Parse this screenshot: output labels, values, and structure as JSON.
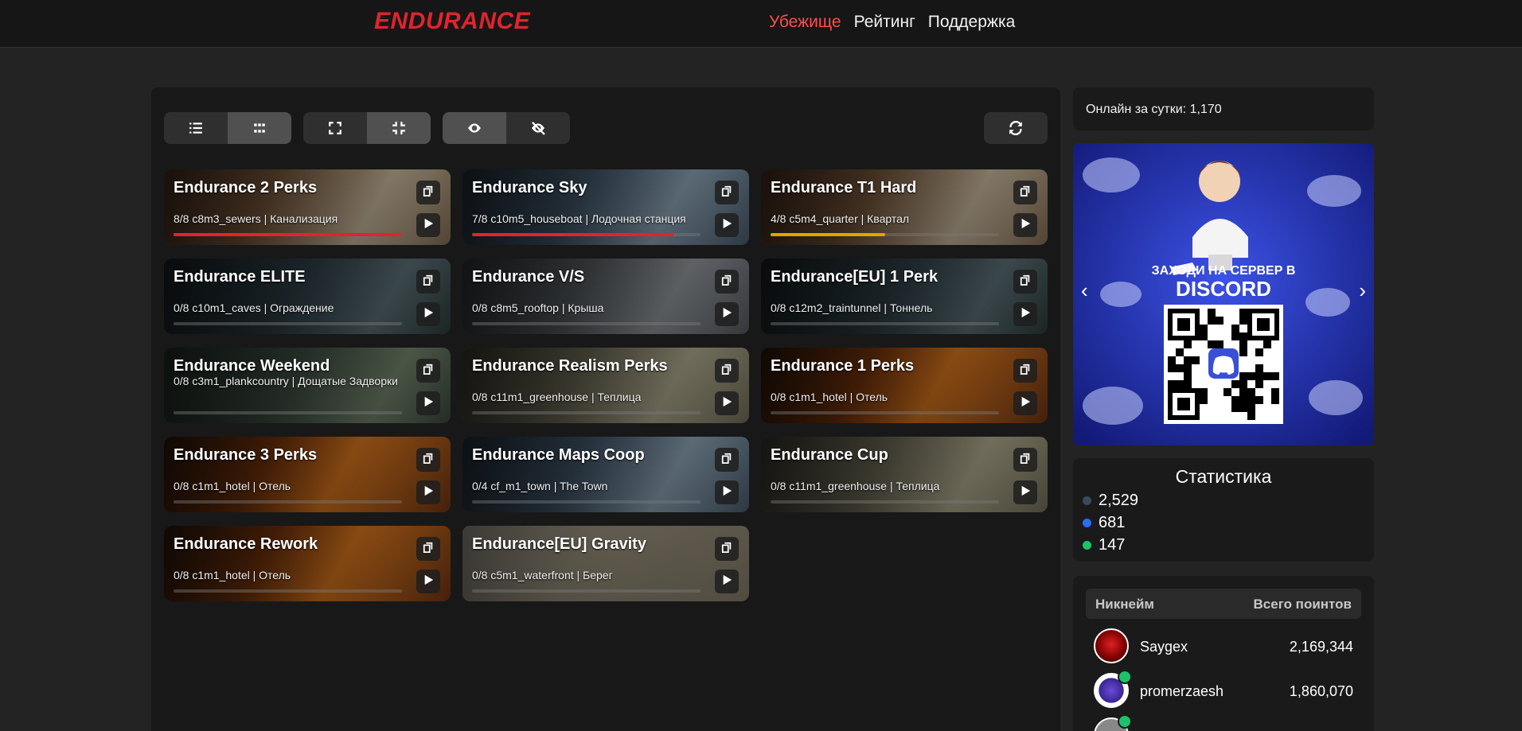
{
  "header": {
    "logo": "ENDURANCE",
    "nav": [
      {
        "label": "Убежище",
        "active": true
      },
      {
        "label": "Рейтинг",
        "active": false
      },
      {
        "label": "Поддержка",
        "active": false
      }
    ]
  },
  "toolbar": {
    "icons": [
      "list-icon",
      "grid-icon",
      "expand-icon",
      "compress-icon",
      "eye-icon",
      "eye-slash-icon",
      "refresh-icon"
    ]
  },
  "servers": [
    {
      "name": "Endurance 2 Perks",
      "info": "8/8 c8m3_sewers | Канализация",
      "fill": 100,
      "color": "#e0242d",
      "theme": "street"
    },
    {
      "name": "Endurance Sky",
      "info": "7/8 c10m5_houseboat | Лодочная станция",
      "fill": 88,
      "color": "#e0242d",
      "theme": "blue"
    },
    {
      "name": "Endurance T1 Hard",
      "info": "4/8 c5m4_quarter | Квартал",
      "fill": 50,
      "color": "#e0a500",
      "theme": "street"
    },
    {
      "name": "Endurance ELITE",
      "info": "0/8 c10m1_caves | Ограждение",
      "fill": 0,
      "color": "#888888",
      "theme": "dark"
    },
    {
      "name": "Endurance V/S",
      "info": "0/8 c8m5_rooftop | Крыша",
      "fill": 0,
      "color": "#888888",
      "theme": "gray"
    },
    {
      "name": "Endurance[EU] 1 Perk",
      "info": "0/8 c12m2_traintunnel | Тоннель",
      "fill": 0,
      "color": "#888888",
      "theme": "dark"
    },
    {
      "name": "Endurance Weekend",
      "info": "0/8 c3m1_plankcountry | Дощатые Задворки",
      "fill": 0,
      "color": "#888888",
      "theme": "green",
      "tall": true
    },
    {
      "name": "Endurance Realism Perks",
      "info": "0/8 c11m1_greenhouse | Теплица",
      "fill": 0,
      "color": "#888888",
      "theme": "plain"
    },
    {
      "name": "Endurance 1 Perks",
      "info": "0/8 c1m1_hotel | Отель",
      "fill": 0,
      "color": "#888888",
      "theme": "fire"
    },
    {
      "name": "Endurance 3 Perks",
      "info": "0/8 c1m1_hotel | Отель",
      "fill": 0,
      "color": "#888888",
      "theme": "fire"
    },
    {
      "name": "Endurance Maps Coop",
      "info": "0/4 cf_m1_town | The Town",
      "fill": 0,
      "color": "#888888",
      "theme": "blue"
    },
    {
      "name": "Endurance Cup",
      "info": "0/8 c11m1_greenhouse | Теплица",
      "fill": 0,
      "color": "#888888",
      "theme": "plain"
    },
    {
      "name": "Endurance Rework",
      "info": "0/8 c1m1_hotel | Отель",
      "fill": 0,
      "color": "#888888",
      "theme": "fire"
    },
    {
      "name": "Endurance[EU] Gravity",
      "info": "0/8 c5m1_waterfront | Берег",
      "fill": 0,
      "color": "#888888",
      "theme": "light"
    }
  ],
  "online": {
    "text": "Онлайн за сутки: 1,170"
  },
  "banner": {
    "line1": "ЗАХОДИ НА СЕРВЕР В",
    "line2": "DISCORD"
  },
  "stats": {
    "title": "Статистика",
    "items": [
      {
        "value": "2,529",
        "color": "#3a4a5c"
      },
      {
        "value": "681",
        "color": "#2b6cf0"
      },
      {
        "value": "147",
        "color": "#1cc36b"
      }
    ]
  },
  "rating": {
    "col_nick": "Никнейм",
    "col_points": "Всего поинтов",
    "rows": [
      {
        "nick": "Saygex",
        "points": "2,169,344",
        "online": false
      },
      {
        "nick": "promerzaesh",
        "points": "1,860,070",
        "online": true
      }
    ]
  }
}
